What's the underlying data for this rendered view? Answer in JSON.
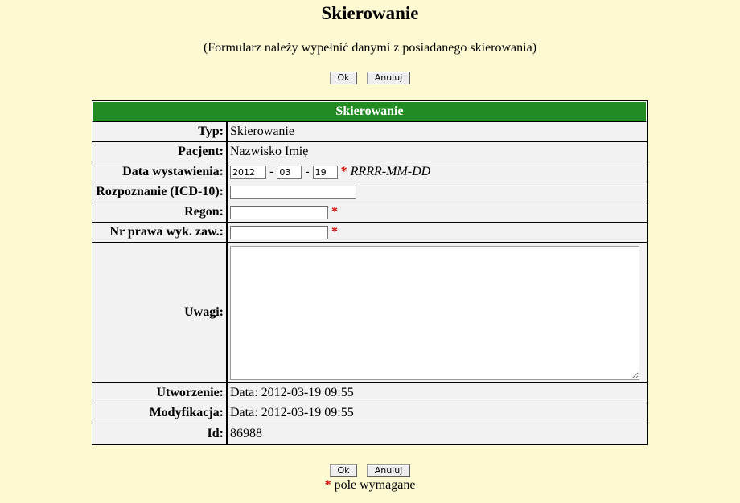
{
  "page": {
    "title": "Skierowanie",
    "subtitle": "(Formularz należy wypełnić danymi z posiadanego skierowania)",
    "ok_label": "Ok",
    "cancel_label": "Anuluj"
  },
  "form": {
    "header": "Skierowanie",
    "type": {
      "label": "Typ:",
      "value": "Skierowanie"
    },
    "patient": {
      "label": "Pacjent:",
      "value": "Nazwisko Imię"
    },
    "issue_date": {
      "label": "Data wystawienia:",
      "year": "2012",
      "month": "03",
      "day": "19",
      "separator": "-",
      "required_mark": "*",
      "format_hint": "RRRR-MM-DD"
    },
    "diagnosis": {
      "label": "Rozpoznanie (ICD-10):",
      "value": ""
    },
    "regon": {
      "label": "Regon:",
      "value": "",
      "required_mark": "*"
    },
    "license": {
      "label": "Nr prawa wyk. zaw.:",
      "value": "",
      "required_mark": "*"
    },
    "notes": {
      "label": "Uwagi:",
      "value": ""
    },
    "created": {
      "label": "Utworzenie:",
      "value": "Data: 2012-03-19 09:55"
    },
    "modified": {
      "label": "Modyfikacja:",
      "value": "Data: 2012-03-19 09:55"
    },
    "id": {
      "label": "Id:",
      "value": "86988"
    }
  },
  "footer": {
    "required_mark": "*",
    "required_note": " pole wymagane"
  },
  "colors": {
    "background": "#fdf9d3",
    "header_green": "#228b22",
    "row_gray": "#f2f2f2",
    "required_red": "#e00000"
  }
}
